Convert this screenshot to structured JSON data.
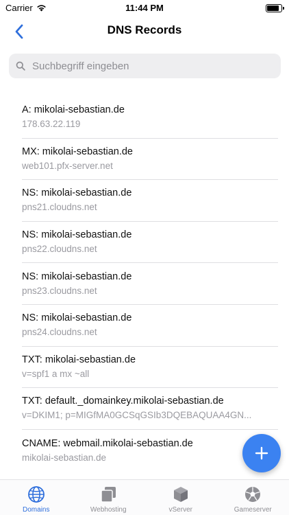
{
  "status_bar": {
    "carrier": "Carrier",
    "time": "11:44 PM",
    "battery_level": 0.85
  },
  "nav": {
    "title": "DNS Records"
  },
  "search": {
    "placeholder": "Suchbegriff eingeben"
  },
  "records": [
    {
      "title": "A: mikolai-sebastian.de",
      "value": "178.63.22.119"
    },
    {
      "title": "MX: mikolai-sebastian.de",
      "value": "web101.pfx-server.net"
    },
    {
      "title": "NS: mikolai-sebastian.de",
      "value": "pns21.cloudns.net"
    },
    {
      "title": "NS: mikolai-sebastian.de",
      "value": "pns22.cloudns.net"
    },
    {
      "title": "NS: mikolai-sebastian.de",
      "value": "pns23.cloudns.net"
    },
    {
      "title": "NS: mikolai-sebastian.de",
      "value": "pns24.cloudns.net"
    },
    {
      "title": "TXT: mikolai-sebastian.de",
      "value": "v=spf1 a mx ~all"
    },
    {
      "title": "TXT: default._domainkey.mikolai-sebastian.de",
      "value": "v=DKIM1; p=MIGfMA0GCSqGSIb3DQEBAQUAA4GN..."
    },
    {
      "title": "CNAME: webmail.mikolai-sebastian.de",
      "value": "mikolai-sebastian.de"
    }
  ],
  "tabs": [
    {
      "label": "Domains",
      "icon": "globe-icon",
      "active": true
    },
    {
      "label": "Webhosting",
      "icon": "stack-icon",
      "active": false
    },
    {
      "label": "vServer",
      "icon": "cube-icon",
      "active": false
    },
    {
      "label": "Gameserver",
      "icon": "soccer-ball-icon",
      "active": false
    }
  ],
  "colors": {
    "accent": "#3b82f1",
    "tab_active": "#2f6fdc",
    "tab_inactive": "#8e8e93",
    "secondary_text": "#9a9aa0"
  }
}
